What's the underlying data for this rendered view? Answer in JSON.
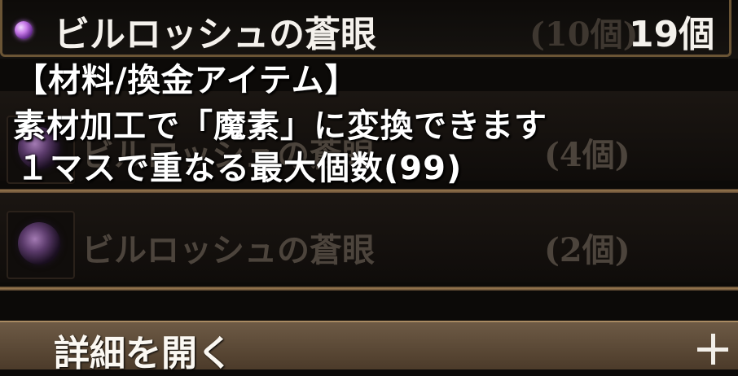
{
  "selected_item": {
    "name": "ビルロッシュの蒼眼",
    "subqty": "(10個)",
    "quantity": "19個",
    "icon": "purple-orb-icon"
  },
  "description": {
    "category": "【材料/換金アイテム】",
    "line1": "素材加工で「魔素」に変換できます",
    "line2": "１マスで重なる最大個数(99)"
  },
  "list": {
    "items": [
      {
        "name": "ビルロッシュの蒼眼",
        "count": "(4個)",
        "icon": "purple-orb-icon"
      },
      {
        "name": "ビルロッシュの蒼眼",
        "count": "(2個)",
        "icon": "purple-orb-icon"
      }
    ]
  },
  "footer": {
    "label": "詳細を開く",
    "icon": "plus-icon"
  }
}
